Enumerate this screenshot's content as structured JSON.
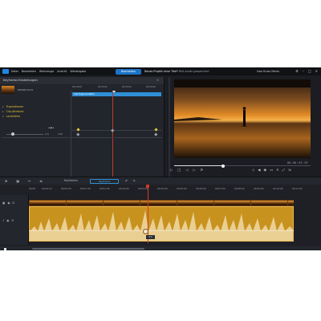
{
  "menu": {
    "items": [
      "Datei",
      "Bearbeiten",
      "Werkzeuge",
      "Ansicht",
      "Wiedergabe"
    ],
    "edit_button": "Bearbeiten",
    "project_label": "Neues Projekt ohne Titel*",
    "project_status": "Bild wurde gespeichert",
    "user": "Uwe Krass Mestu"
  },
  "keyframe_panel": {
    "title": "Keyframe-Einstellungen",
    "clip_name": "DSD00712.D",
    "ruler": [
      "00:00:00",
      "00:00:02",
      "00:00:04",
      "00:00:06"
    ],
    "clip_bar_label": "Clip Eigenschaften",
    "properties": [
      {
        "label": "Fixpositionen",
        "active": true
      },
      {
        "label": "Clip-Attribute",
        "active": true
      },
      {
        "label": "Lautstärke",
        "active": true
      }
    ],
    "volume_value": "0.0",
    "volume_value2": "100"
  },
  "preview": {
    "time": "00 : 00 : 07 : 07"
  },
  "timeline": {
    "keyframe_button": "Keyframe",
    "toolbar_text": "Keyframes",
    "ruler": [
      "00:00",
      "00:00:10",
      "00:00:20",
      "00:01:30",
      "00:01:40",
      "00:02:00",
      "00:03:00",
      "00:04:00",
      "00:05:00",
      "00:06:00",
      "00:07:00",
      "00:08:00",
      "00:09:00",
      "00:10:00",
      "00:11:00",
      "00:12:00",
      "00:13:00",
      "00:14:00"
    ],
    "handle_value": "0.0"
  },
  "colors": {
    "accent": "#1e73c8",
    "keyframe": "#e0c33a",
    "audio_clip": "#c8921e",
    "playhead": "#d23b2b"
  }
}
